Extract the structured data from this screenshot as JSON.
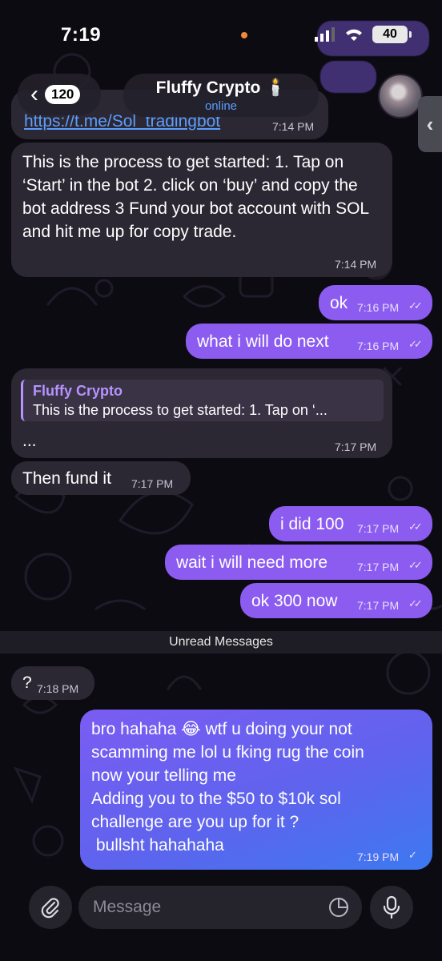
{
  "status_bar": {
    "time": "7:19",
    "battery": "40"
  },
  "header": {
    "back_count": "120",
    "title": "Fluffy Crypto 🕯️",
    "status": "online"
  },
  "messages": [
    {
      "id": "m0",
      "dir": "in",
      "text": "https://t.me/Sol_tradingbot",
      "time": "7:14 PM"
    },
    {
      "id": "m1",
      "dir": "in",
      "text": "This is the process to get started:  1. Tap on ‘Start’ in the bot   2. click on  ‘buy’ and copy the bot address   3 Fund your bot account with SOL and hit me up for copy trade.",
      "time": "7:14 PM"
    },
    {
      "id": "m2",
      "dir": "out",
      "text": "ok",
      "time": "7:16 PM"
    },
    {
      "id": "m3",
      "dir": "out",
      "text": "what i will do next",
      "time": "7:16 PM"
    },
    {
      "id": "m4",
      "dir": "in",
      "reply_name": "Fluffy Crypto",
      "reply_snippet": "This is the process to get started: 1. Tap on ‘...",
      "text": "...",
      "time": "7:17 PM"
    },
    {
      "id": "m5",
      "dir": "in",
      "text": "Then fund it",
      "time": "7:17 PM"
    },
    {
      "id": "m6",
      "dir": "out",
      "text": "i did 100",
      "time": "7:17 PM"
    },
    {
      "id": "m7",
      "dir": "out",
      "text": "wait i will need more",
      "time": "7:17 PM"
    },
    {
      "id": "m8",
      "dir": "out",
      "text": "ok 300 now",
      "time": "7:17 PM"
    },
    {
      "id": "m9",
      "dir": "in",
      "text": "?",
      "time": "7:18 PM"
    },
    {
      "id": "m10",
      "dir": "out",
      "lines": [
        "bro hahaha 😂 wtf u doing your not",
        "scamming me lol  u fking rug the coin",
        "now your telling me",
        "Adding you to the $50 to $10k sol",
        "challenge are you up for it ?",
        " bullsht hahahaha"
      ],
      "time": "7:19 PM"
    }
  ],
  "unread_label": "Unread Messages",
  "composer": {
    "placeholder": "Message"
  },
  "colors": {
    "outgoing": "#8c5cf0",
    "incoming": "#2c2833",
    "link": "#5b9dff",
    "accent": "#b693ff"
  }
}
